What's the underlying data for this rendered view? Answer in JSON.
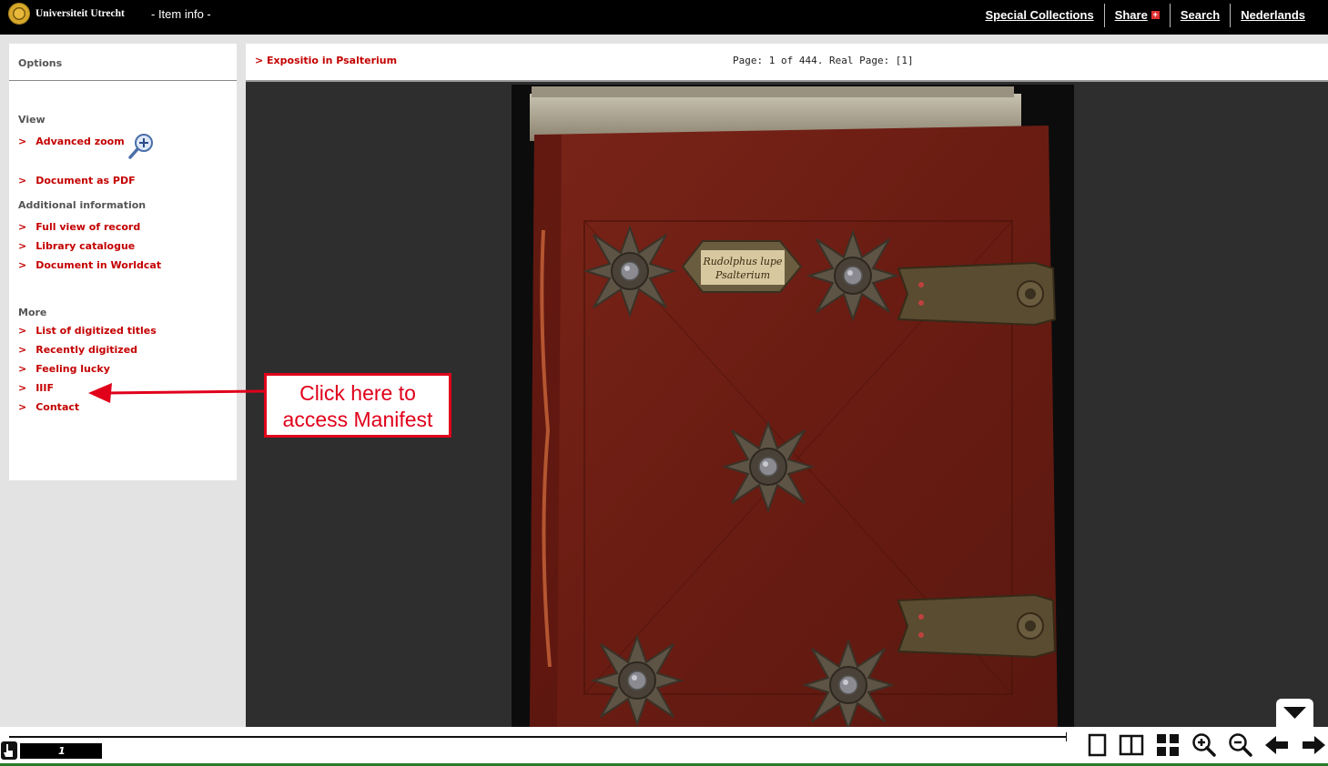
{
  "header": {
    "logo_text": "Universiteit Utrecht",
    "item_info": "- Item info -",
    "nav": {
      "special_collections": "Special Collections",
      "share": "Share",
      "search": "Search",
      "nederlands": "Nederlands"
    }
  },
  "sidebar": {
    "title": "Options",
    "sections": {
      "view": "View",
      "additional": "Additional information",
      "more": "More"
    },
    "links": {
      "advanced_zoom": "Advanced zoom",
      "document_pdf": "Document as PDF",
      "full_view": "Full view of record",
      "library_catalogue": "Library catalogue",
      "worldcat": "Document in Worldcat",
      "digitized_titles": "List of digitized titles",
      "recently_digitized": "Recently digitized",
      "feeling_lucky": "Feeling lucky",
      "iiif": "IIIF",
      "contact": "Contact"
    },
    "chevron": ">"
  },
  "viewer": {
    "title": "> Expositio in Psalterium",
    "page_info": "Page: 1 of 444. Real Page: [1]",
    "book_label": "Rudolphus lupe",
    "book_label_2": "Psalterium"
  },
  "bottom": {
    "current_page": "1"
  },
  "annotation": {
    "line1": "Click here to",
    "line2": "access Manifest"
  },
  "colors": {
    "link_red": "#c40000",
    "annotation_red": "#e0001a",
    "topbar": "#000000",
    "viewer_bg": "#2e2e2e",
    "leather": "#6e1e14"
  }
}
